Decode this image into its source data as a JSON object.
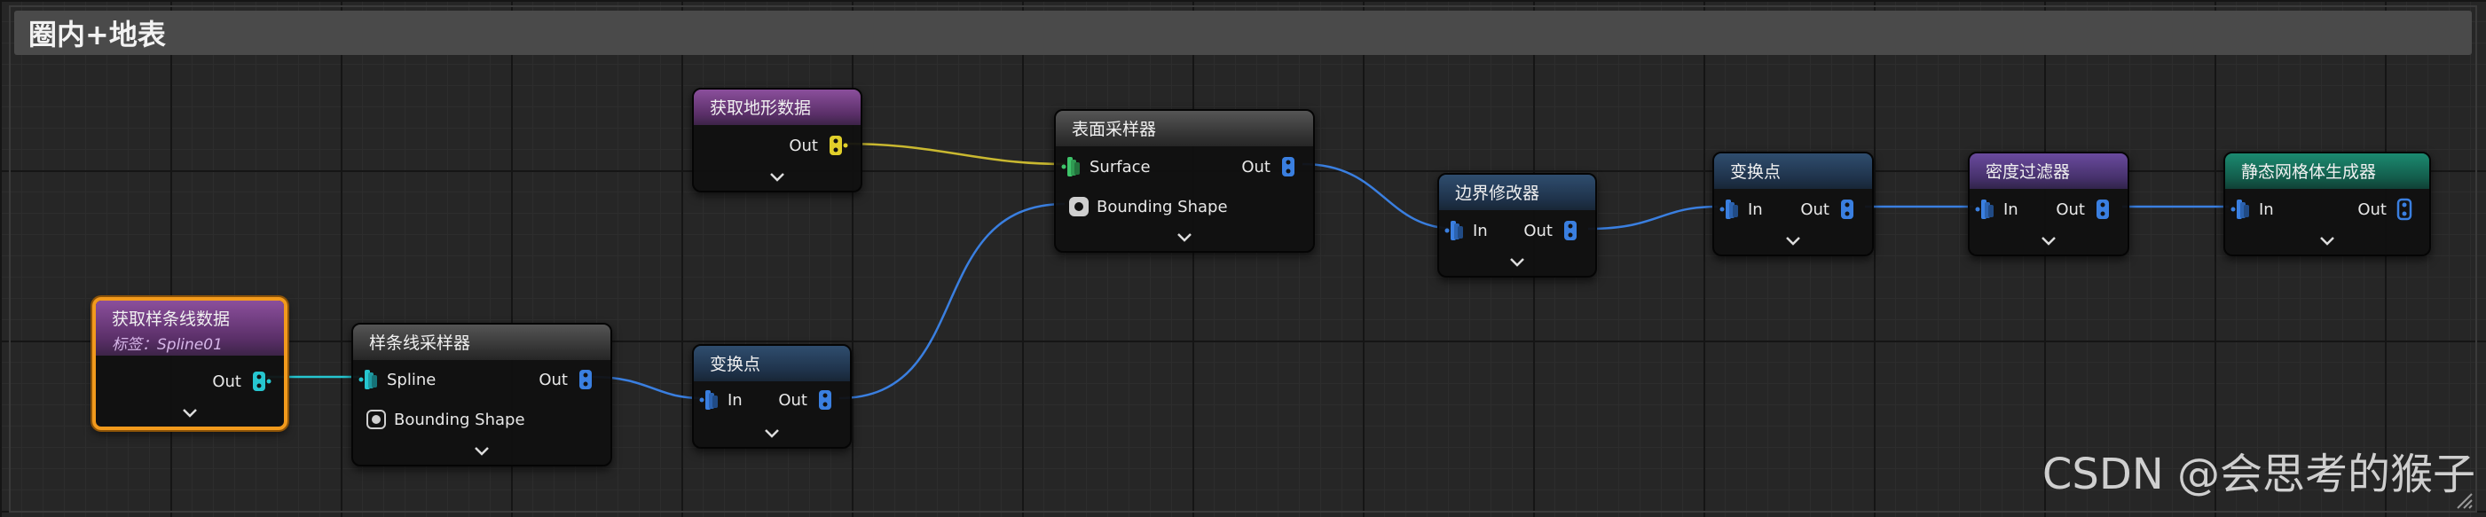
{
  "comment": {
    "title": "圈内+地表"
  },
  "nodes": {
    "get_spline_data": {
      "title": "获取样条线数据",
      "subtitle": "标签：Spline01",
      "out": "Out"
    },
    "spline_sampler": {
      "title": "样条线采样器",
      "in_spline": "Spline",
      "in_bounds": "Bounding Shape",
      "out": "Out"
    },
    "transform_1": {
      "title": "变换点",
      "in": "In",
      "out": "Out"
    },
    "get_landscape": {
      "title": "获取地形数据",
      "out": "Out"
    },
    "surface_sampler": {
      "title": "表面采样器",
      "in_surface": "Surface",
      "in_bounds": "Bounding Shape",
      "out": "Out"
    },
    "bounds_modifier": {
      "title": "边界修改器",
      "in": "In",
      "out": "Out"
    },
    "transform_2": {
      "title": "变换点",
      "in": "In",
      "out": "Out"
    },
    "density_filter": {
      "title": "密度过滤器",
      "in": "In",
      "out": "Out"
    },
    "static_mesh": {
      "title": "静态网格体生成器",
      "in": "In",
      "out": "Out"
    }
  },
  "watermark": "CSDN @会思考的猴子",
  "colors": {
    "selection": "#f29a1c",
    "wire_spline": "#26c6d0",
    "wire_landscape": "#c9b830",
    "wire_points": "#3a7fe0",
    "pin_points": "#3a7fe0",
    "pin_spline": "#26c6d0",
    "pin_surface": "#3ec46a",
    "pin_landscape": "#e0cf2a"
  }
}
